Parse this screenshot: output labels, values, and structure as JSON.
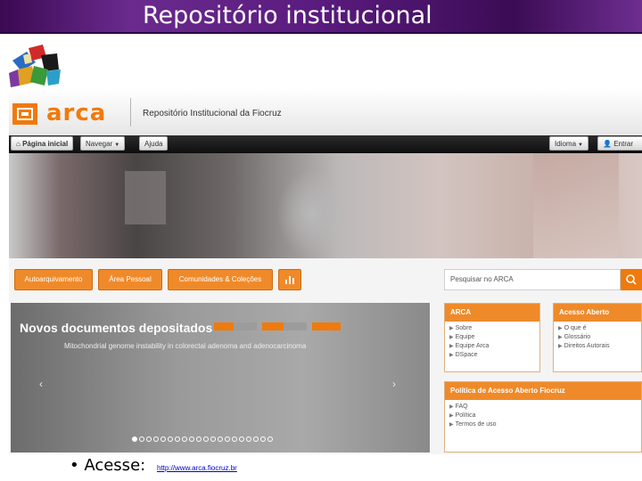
{
  "slide": {
    "title": "Repositório institucional",
    "bullet_text": "• Acesse:",
    "link_text": "http://www.arca.fiocruz.br"
  },
  "site": {
    "logo_text": "arca",
    "repository_name": "Repositório Institucional da Fiocruz",
    "nav": {
      "home": "Página inicial",
      "browse": "Navegar",
      "help": "Ajuda",
      "language": "Idioma",
      "login": "Entrar"
    },
    "actions": {
      "self_archive": "Autoarquivamento",
      "personal_area": "Área Pessoal",
      "communities": "Comunidades & Coleções"
    },
    "search_placeholder": "Pesquisar no ARCA",
    "carousel": {
      "title": "Novos documentos depositados",
      "subtitle": "Mitochondrial genome instability in colorectal adenoma and adenocarcinoma",
      "prev": "‹",
      "next": "›",
      "dot_count": 20,
      "active_dot": 0
    },
    "panels": {
      "arca": {
        "title": "ARCA",
        "items": [
          "Sobre",
          "Equipe",
          "Equipe Arca",
          "DSpace"
        ]
      },
      "open_access": {
        "title": "Acesso Aberto",
        "items": [
          "O que é",
          "Glossário",
          "Direitos Autorais"
        ]
      },
      "policy": {
        "title": "Política de Acesso Aberto Fiocruz",
        "items": [
          "FAQ",
          "Política",
          "Termos de uso"
        ]
      }
    }
  },
  "colors": {
    "accent": "#f07a0c",
    "title_bar": "#5a1b7e"
  },
  "icons": [
    "cube-collage-logo",
    "arca-logo-icon",
    "home-icon",
    "user-icon",
    "chart-icon",
    "search-icon"
  ]
}
